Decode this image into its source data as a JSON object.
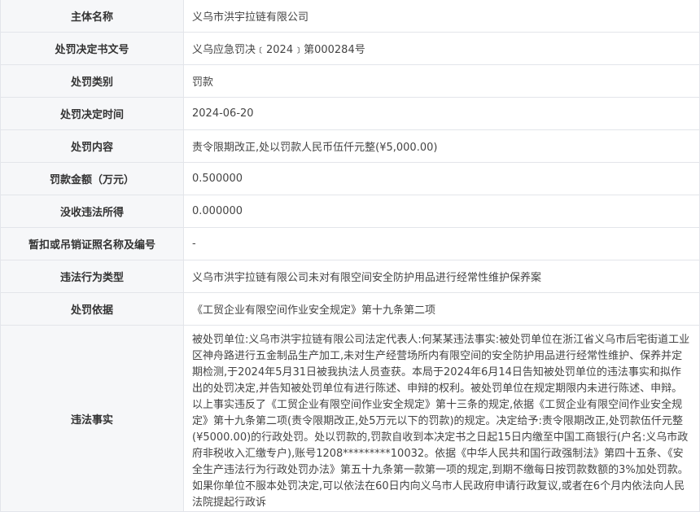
{
  "rows": [
    {
      "label": "主体名称",
      "value": "义乌市洪宇拉链有限公司"
    },
    {
      "label": "处罚决定书文号",
      "value": "义乌应急罚决﹝2024﹞第000284号"
    },
    {
      "label": "处罚类别",
      "value": "罚款"
    },
    {
      "label": "处罚决定时间",
      "value": "2024-06-20"
    },
    {
      "label": "处罚内容",
      "value": "责令限期改正,处以罚款人民币伍仟元整(¥5,000.00)"
    },
    {
      "label": "罚款金额（万元）",
      "value": "0.500000"
    },
    {
      "label": "没收违法所得",
      "value": "0.000000"
    },
    {
      "label": "暂扣或吊销证照名称及编号",
      "value": "-"
    },
    {
      "label": "违法行为类型",
      "value": "义乌市洪宇拉链有限公司未对有限空间安全防护用品进行经常性维护保养案"
    },
    {
      "label": "处罚依据",
      "value": "《工贸企业有限空间作业安全规定》第十九条第二项"
    },
    {
      "label": "违法事实",
      "value": "被处罚单位:义乌市洪宇拉链有限公司法定代表人:何某某违法事实:被处罚单位在浙江省义乌市后宅街道工业区神舟路进行五金制品生产加工,未对生产经营场所内有限空间的安全防护用品进行经常性维护、保养并定期检测,于2024年5月31日被我执法人员查获。本局于2024年6月14日告知被处罚单位的违法事实和拟作出的处罚决定,并告知被处罚单位有进行陈述、申辩的权利。被处罚单位在规定期限内未进行陈述、申辩。以上事实违反了《工贸企业有限空间作业安全规定》第十三条的规定,依据《工贸企业有限空间作业安全规定》第十九条第二项(责令限期改正,处5万元以下的罚款)的规定。决定给予:责令限期改正,处罚款伍仟元整(¥5000.00)的行政处罚。处以罚款的,罚款自收到本决定书之日起15日内缴至中国工商银行(户名:义乌市政府非税收入汇缴专户),账号1208*********10032。依据《中华人民共和国行政强制法》第四十五条、《安全生产违法行为行政处罚办法》第五十九条第一款第一项的规定,到期不缴每日按罚款数额的3%加处罚款。如果你单位不服本处罚决定,可以依法在60日内向义乌市人民政府申请行政复议,或者在6个月内依法向人民法院提起行政诉"
    }
  ]
}
